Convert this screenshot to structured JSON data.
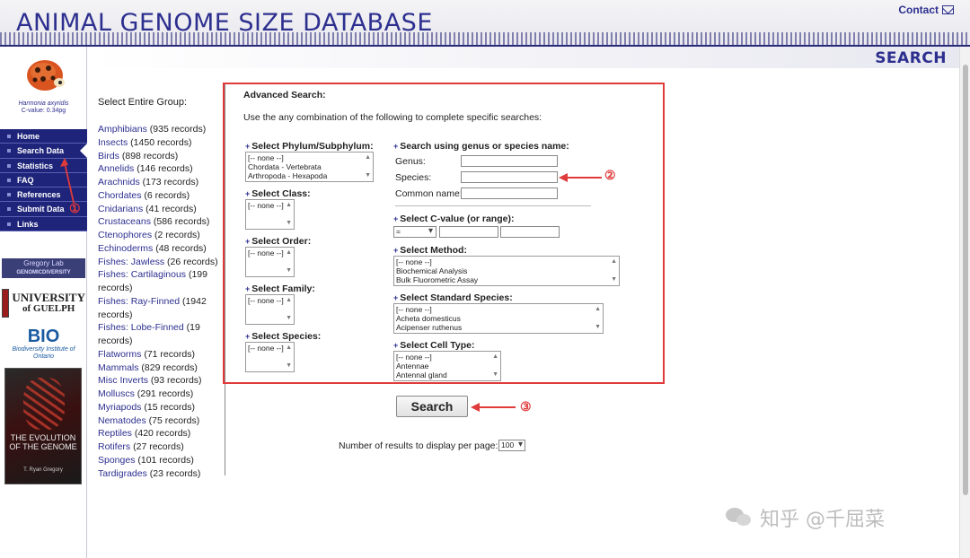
{
  "header": {
    "title": "ANIMAL GENOME SIZE DATABASE",
    "contact_label": "Contact"
  },
  "sidebar": {
    "species_name": "Harmonia axyridis",
    "species_cvalue": "C-value: 0.34pg",
    "nav": [
      {
        "label": "Home"
      },
      {
        "label": "Search Data"
      },
      {
        "label": "Statistics"
      },
      {
        "label": "FAQ"
      },
      {
        "label": "References"
      },
      {
        "label": "Submit Data"
      },
      {
        "label": "Links"
      }
    ],
    "sponsors": {
      "gregory_lab": "Gregory Lab",
      "gregory_lab_sub": "GENOMICDIVERSITY",
      "guelph_line1": "UNIVERSITY",
      "guelph_line2": "of GUELPH",
      "bio_big": "BIO",
      "bio_small": "Biodiversity Institute of Ontario",
      "book_title": "THE EVOLUTION OF THE GENOME",
      "book_author": "T. Ryan Gregory"
    }
  },
  "page": {
    "heading": "SEARCH"
  },
  "groups": {
    "title": "Select Entire Group:",
    "items": [
      {
        "name": "Amphibians",
        "count": " (935 records)"
      },
      {
        "name": "Insects",
        "count": " (1450 records)"
      },
      {
        "name": "Birds",
        "count": " (898 records)"
      },
      {
        "name": "Annelids",
        "count": " (146 records)"
      },
      {
        "name": "Arachnids",
        "count": " (173 records)"
      },
      {
        "name": "Chordates",
        "count": " (6 records)"
      },
      {
        "name": "Cnidarians",
        "count": " (41 records)"
      },
      {
        "name": "Crustaceans",
        "count": " (586 records)"
      },
      {
        "name": "Ctenophores",
        "count": " (2 records)"
      },
      {
        "name": "Echinoderms",
        "count": " (48 records)"
      },
      {
        "name": "Fishes: Jawless",
        "count": " (26 records)"
      },
      {
        "name": "Fishes: Cartilaginous",
        "count": " (199 records)"
      },
      {
        "name": "Fishes: Ray-Finned",
        "count": " (1942 records)"
      },
      {
        "name": "Fishes: Lobe-Finned",
        "count": " (19 records)"
      },
      {
        "name": "Flatworms",
        "count": " (71 records)"
      },
      {
        "name": "Mammals",
        "count": " (829 records)"
      },
      {
        "name": "Misc Inverts",
        "count": " (93 records)"
      },
      {
        "name": "Molluscs",
        "count": " (291 records)"
      },
      {
        "name": "Myriapods",
        "count": " (15 records)"
      },
      {
        "name": "Nematodes",
        "count": " (75 records)"
      },
      {
        "name": "Reptiles",
        "count": " (420 records)"
      },
      {
        "name": "Rotifers",
        "count": " (27 records)"
      },
      {
        "name": "Sponges",
        "count": " (101 records)"
      },
      {
        "name": "Tardigrades",
        "count": " (23 records)"
      }
    ]
  },
  "advanced": {
    "title": "Advanced Search:",
    "description": "Use the any combination of the following to complete specific searches:",
    "phylum": {
      "label": "Select Phylum/Subphylum:",
      "options": [
        "[-- none --]",
        "Chordata - Vertebrata",
        "Arthropoda - Hexapoda"
      ]
    },
    "class": {
      "label": "Select Class:",
      "options": [
        "[-- none --]"
      ]
    },
    "order": {
      "label": "Select Order:",
      "options": [
        "[-- none --]"
      ]
    },
    "family": {
      "label": "Select Family:",
      "options": [
        "[-- none --]"
      ]
    },
    "species": {
      "label": "Select Species:",
      "options": [
        "[-- none --]"
      ]
    },
    "name_search": {
      "label": "Search using genus or species name:",
      "genus_label": "Genus:",
      "species_label": "Species:",
      "common_label": "Common name:"
    },
    "cvalue": {
      "label": "Select C-value (or range):",
      "operator": "="
    },
    "method": {
      "label": "Select Method:",
      "options": [
        "[-- none --]",
        "Biochemical Analysis",
        "Bulk Fluorometric Assay"
      ]
    },
    "standard": {
      "label": "Select Standard Species:",
      "options": [
        "[-- none --]",
        "Acheta domesticus",
        "Acipenser ruthenus"
      ]
    },
    "cell_type": {
      "label": "Select Cell Type:",
      "options": [
        "[-- none --]",
        "Antennae",
        "Antennal gland"
      ]
    }
  },
  "actions": {
    "search_label": "Search",
    "results_label": "Number of results to display per page:",
    "results_value": "100"
  },
  "annotations": {
    "one": "①",
    "two": "②",
    "three": "③",
    "color": "#e03a3a"
  },
  "watermark": "知乎 @千屈菜"
}
